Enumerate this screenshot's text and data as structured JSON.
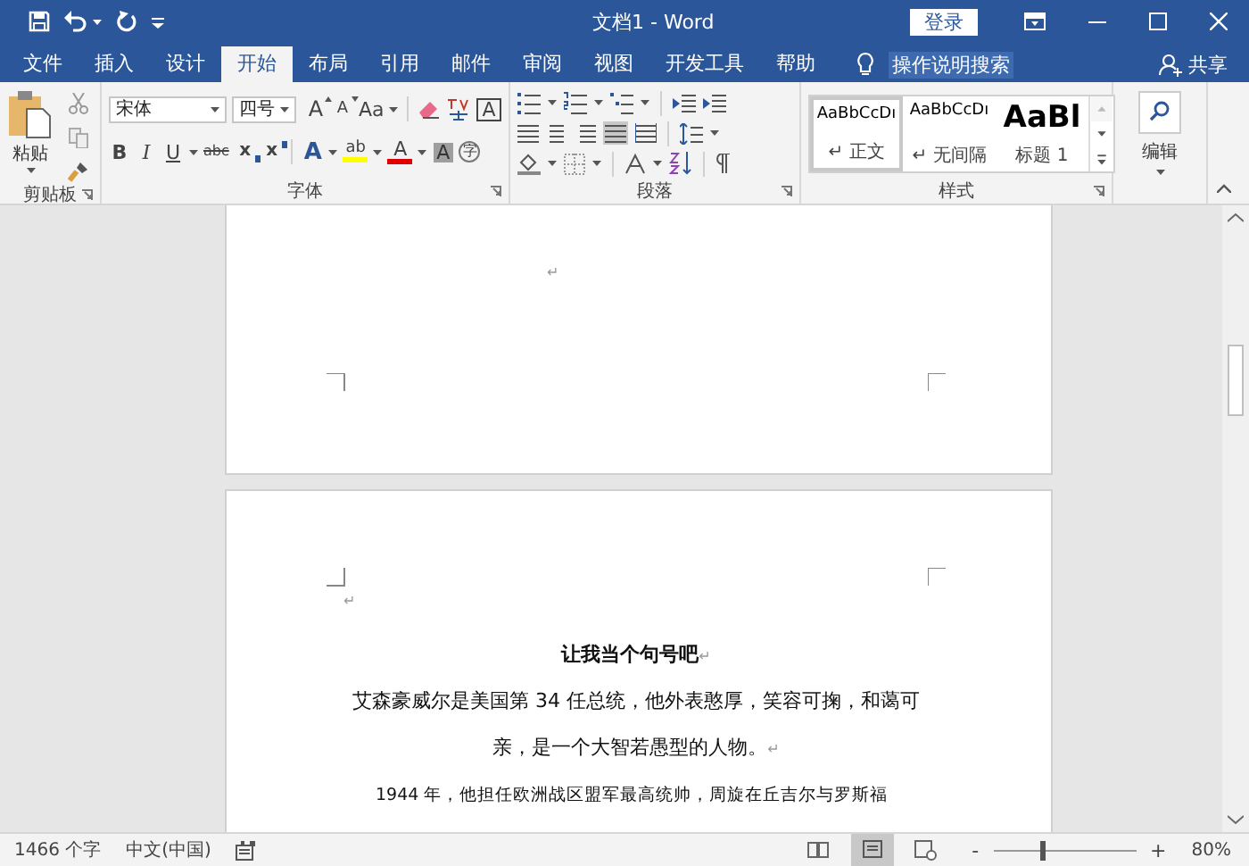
{
  "window": {
    "title": "文档1 - Word",
    "login": "登录"
  },
  "tabs": [
    {
      "label": "文件",
      "selected": false
    },
    {
      "label": "插入",
      "selected": false
    },
    {
      "label": "设计",
      "selected": false
    },
    {
      "label": "开始",
      "selected": true
    },
    {
      "label": "布局",
      "selected": false
    },
    {
      "label": "引用",
      "selected": false
    },
    {
      "label": "邮件",
      "selected": false
    },
    {
      "label": "审阅",
      "selected": false
    },
    {
      "label": "视图",
      "selected": false
    },
    {
      "label": "开发工具",
      "selected": false
    },
    {
      "label": "帮助",
      "selected": false
    }
  ],
  "tell_me": "操作说明搜索",
  "share": "共享",
  "clipboard": {
    "paste": "粘贴",
    "label": "剪贴板"
  },
  "font": {
    "name": "宋体",
    "size": "四号",
    "label": "字体",
    "row1": [
      {
        "kind": "grow",
        "glyph": "A"
      },
      {
        "kind": "shrink",
        "glyph": "A"
      },
      {
        "kind": "case",
        "glyph": "Aa"
      }
    ],
    "row2": [
      {
        "kind": "bold",
        "glyph": "B"
      },
      {
        "kind": "italic",
        "glyph": "I"
      },
      {
        "kind": "underline",
        "glyph": "U"
      },
      {
        "kind": "strike",
        "glyph": "abc"
      },
      {
        "kind": "sub",
        "glyph": "x"
      },
      {
        "kind": "sup",
        "glyph": "x"
      },
      {
        "kind": "effect",
        "glyph": "A"
      },
      {
        "kind": "highlight",
        "glyph": "ab"
      },
      {
        "kind": "color",
        "glyph": "A"
      },
      {
        "kind": "shade",
        "glyph": "A"
      },
      {
        "kind": "enclose",
        "glyph": "字"
      }
    ],
    "border_glyph": "A"
  },
  "paragraph": {
    "label": "段落"
  },
  "styles": {
    "label": "样式",
    "items": [
      {
        "preview": "AaBbCcDı",
        "name": "正文",
        "mark": "↵",
        "kind": "normal",
        "selected": true
      },
      {
        "preview": "AaBbCcDı",
        "name": "无间隔",
        "mark": "↵",
        "kind": "normal",
        "selected": false
      },
      {
        "preview": "AaBl",
        "name": "标题 1",
        "kind": "heading",
        "selected": false
      }
    ]
  },
  "editing": {
    "label": "编辑"
  },
  "document": {
    "page1_marks": [
      "↵"
    ],
    "page2": [
      {
        "kind": "empty",
        "mark": "↵"
      },
      {
        "kind": "title",
        "text": "让我当个句号吧",
        "mark": "↵"
      },
      {
        "kind": "body",
        "text": "艾森豪威尔是美国第 34 任总统，他外表憨厚，笑容可掬，和蔼可亲，是一个大智若愚型的人物。",
        "mark": "↵"
      },
      {
        "kind": "indent",
        "text": "1944 年，他担任欧洲战区盟军最高统帅，周旋在丘吉尔与罗斯福"
      }
    ]
  },
  "status_bar": {
    "words": "1466 个字",
    "language": "中文(中国)",
    "views": [
      {
        "kind": "read",
        "selected": false
      },
      {
        "kind": "print",
        "selected": true
      },
      {
        "kind": "web",
        "selected": false
      }
    ],
    "zoom_out": "-",
    "zoom_in": "+",
    "zoom": {
      "level": 0.34
    },
    "zoom_label": "80%"
  }
}
